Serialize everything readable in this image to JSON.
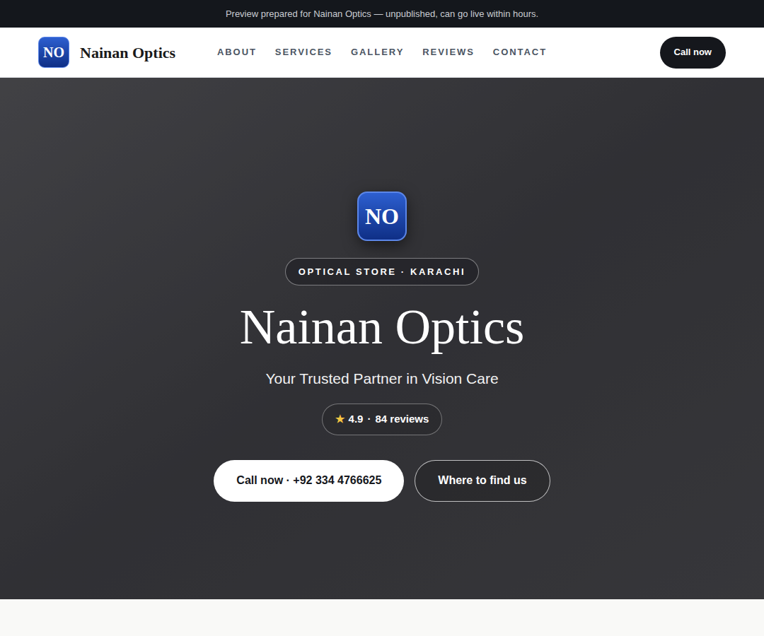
{
  "banner": {
    "text": "Preview prepared for Nainan Optics — unpublished, can go live within hours."
  },
  "nav": {
    "logo": "NO",
    "brand": "Nainan Optics",
    "links": [
      "ABOUT",
      "SERVICES",
      "GALLERY",
      "REVIEWS",
      "CONTACT"
    ],
    "cta": "Call now"
  },
  "hero": {
    "logo": "NO",
    "badge": "OPTICAL STORE · KARACHI",
    "title": "Nainan Optics",
    "subtitle": "Your Trusted Partner in Vision Care",
    "rating": {
      "star": "★",
      "score": "4.9",
      "separator": "·",
      "count": "84 reviews"
    },
    "buttons": [
      {
        "label": "Call now · +92 334 4766625",
        "kind": "primary"
      },
      {
        "label": "Where to find us",
        "kind": "outline"
      }
    ]
  }
}
